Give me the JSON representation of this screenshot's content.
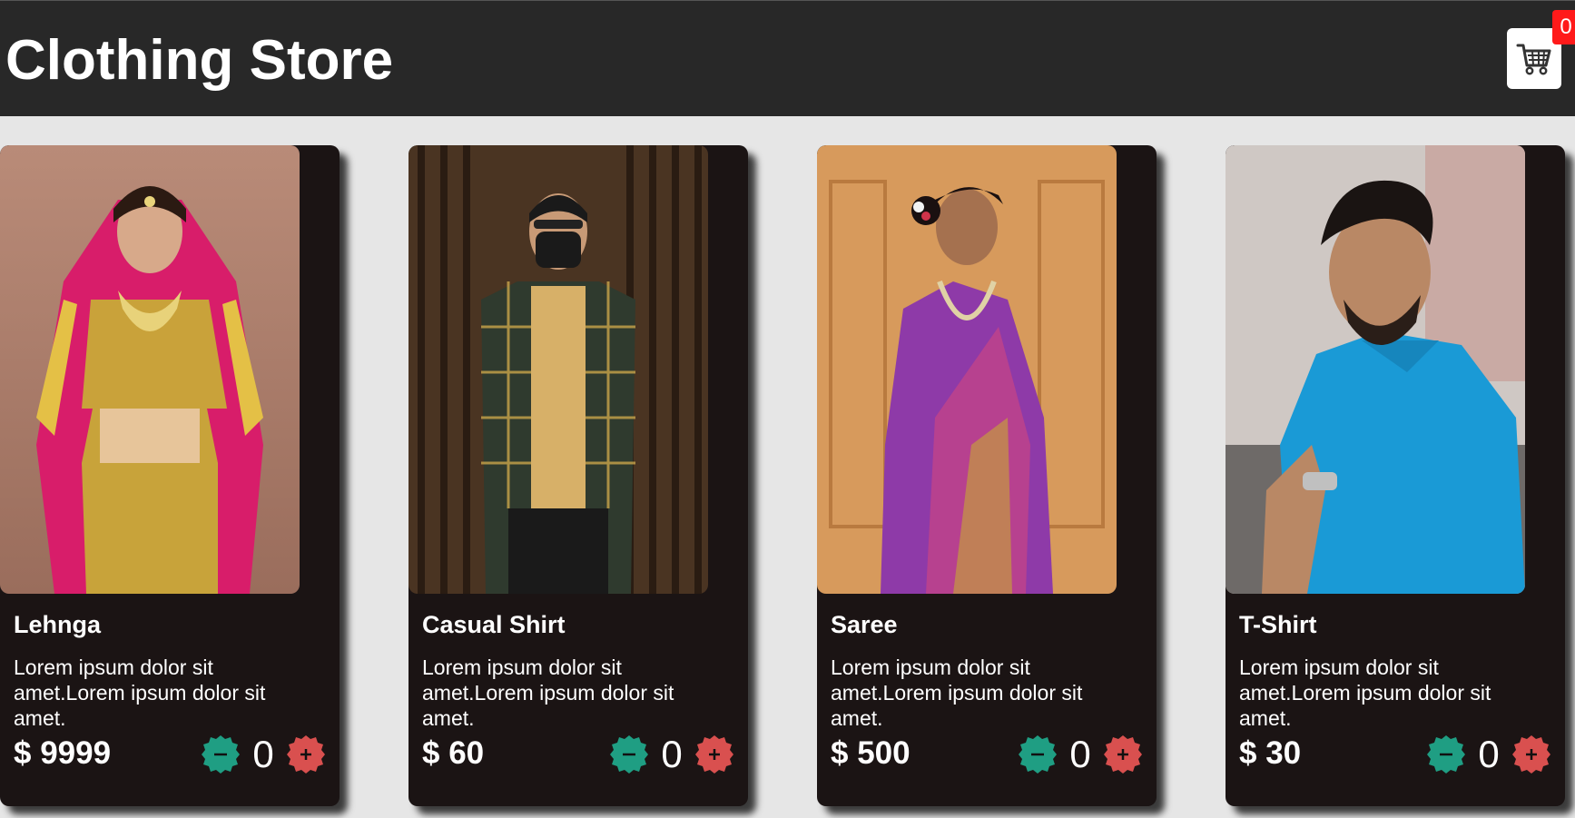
{
  "header": {
    "title": "Clothing Store",
    "cart_icon": "shopping-cart-icon",
    "cart_count": "0"
  },
  "products": [
    {
      "name": "Lehnga",
      "description": "Lorem ipsum dolor sit amet.Lorem ipsum dolor sit amet.",
      "price": "$ 9999",
      "quantity": "0",
      "image_icon": "lehnga-photo"
    },
    {
      "name": "Casual Shirt",
      "description": "Lorem ipsum dolor sit amet.Lorem ipsum dolor sit amet.",
      "price": "$ 60",
      "quantity": "0",
      "image_icon": "casual-shirt-photo"
    },
    {
      "name": "Saree",
      "description": "Lorem ipsum dolor sit amet.Lorem ipsum dolor sit amet.",
      "price": "$ 500",
      "quantity": "0",
      "image_icon": "saree-photo"
    },
    {
      "name": "T-Shirt",
      "description": "Lorem ipsum dolor sit amet.Lorem ipsum dolor sit amet.",
      "price": "$ 30",
      "quantity": "0",
      "image_icon": "t-shirt-photo"
    }
  ],
  "controls": {
    "decrease_icon": "minus-badge-icon",
    "increase_icon": "plus-badge-icon"
  },
  "colors": {
    "header_bg": "#282828",
    "page_bg": "#e6e6e6",
    "card_bg": "#1b1414",
    "minus_button": "#1f9e83",
    "plus_button": "#d9504f",
    "cart_badge": "#ff1a1a"
  }
}
